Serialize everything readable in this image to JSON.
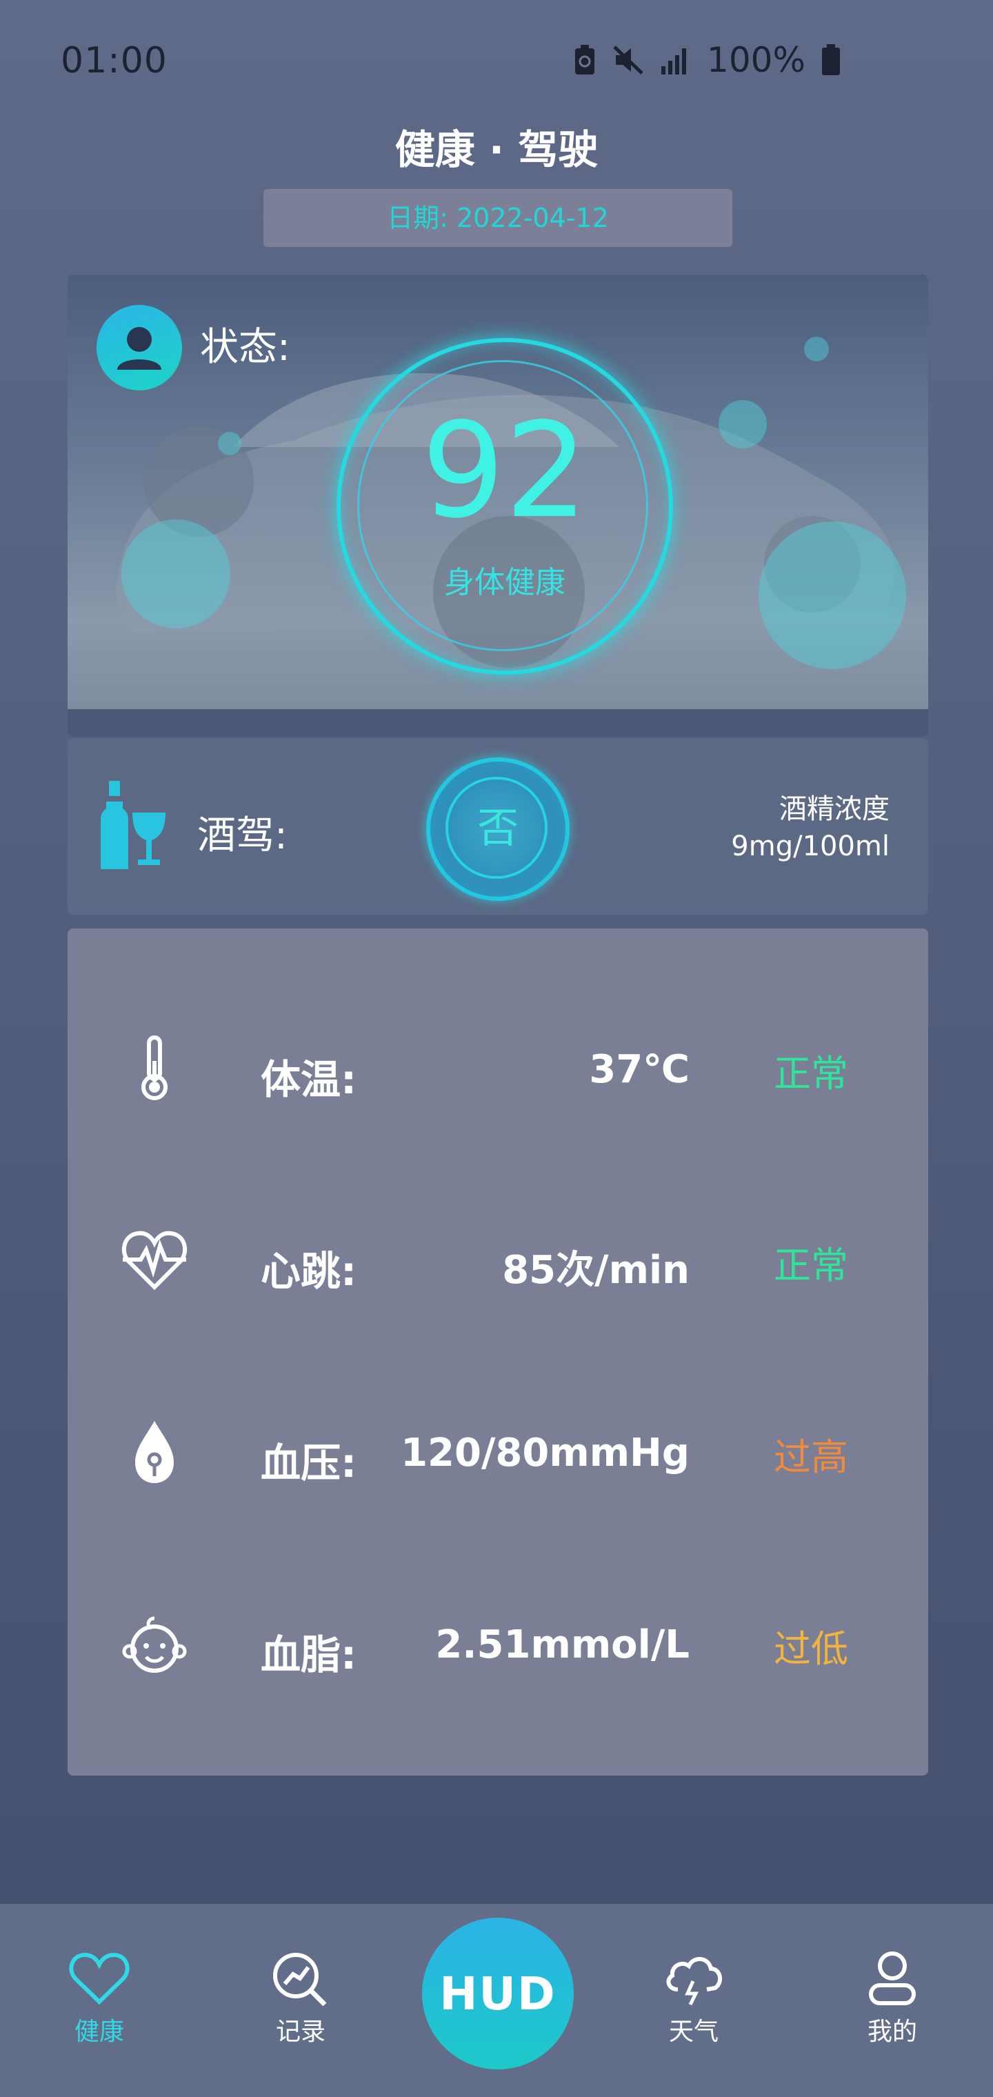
{
  "status_bar": {
    "time": "01:00",
    "battery_percent": "100%"
  },
  "header": {
    "title": "健康 · 驾驶",
    "date": "日期: 2022-04-12"
  },
  "hero": {
    "status_label": "状态:",
    "score": "92",
    "score_label": "身体健康"
  },
  "drink": {
    "label": "酒驾:",
    "value": "否",
    "alcohol_title": "酒精浓度",
    "alcohol_value": "9mg/100ml"
  },
  "metrics": [
    {
      "label": "体温:",
      "value": "37℃",
      "status": "正常",
      "status_color": "#2ee59a",
      "icon": "thermometer-icon"
    },
    {
      "label": "心跳:",
      "value": "85次/min",
      "status": "正常",
      "status_color": "#2ee59a",
      "icon": "heartbeat-icon"
    },
    {
      "label": "血压:",
      "value": "120/80mmHg",
      "status": "过高",
      "status_color": "#f08a3c",
      "icon": "blood-drop-icon"
    },
    {
      "label": "血脂:",
      "value": "2.51mmol/L",
      "status": "过低",
      "status_color": "#f2b43c",
      "icon": "baby-face-icon"
    }
  ],
  "tabs": [
    {
      "label": "健康",
      "icon": "heart-icon",
      "active": true,
      "color": "#2fd9e6"
    },
    {
      "label": "记录",
      "icon": "record-search-icon",
      "active": false
    },
    {
      "label": "HUD",
      "icon": "hud-button"
    },
    {
      "label": "天气",
      "icon": "weather-cloud-icon",
      "active": false
    },
    {
      "label": "我的",
      "icon": "user-icon",
      "active": false
    }
  ]
}
